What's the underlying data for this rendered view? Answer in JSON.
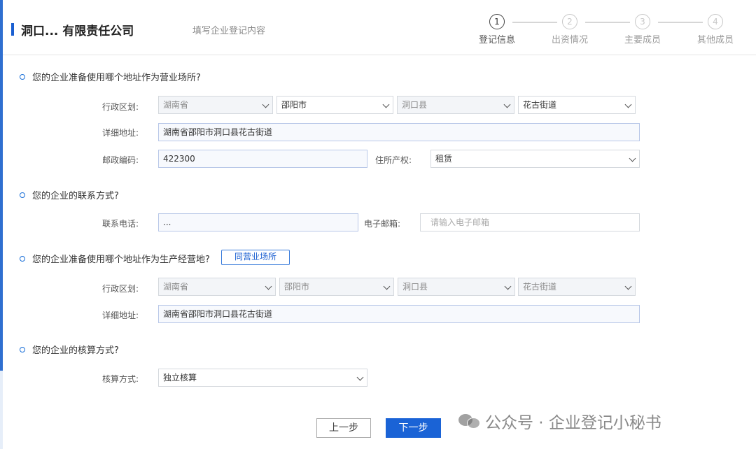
{
  "header": {
    "company_name": "洞口...  有限责任公司",
    "subtitle": "填写企业登记内容"
  },
  "steps": [
    {
      "num": "1",
      "label": "登记信息",
      "active": true
    },
    {
      "num": "2",
      "label": "出资情况",
      "active": false
    },
    {
      "num": "3",
      "label": "主要成员",
      "active": false
    },
    {
      "num": "4",
      "label": "其他成员",
      "active": false
    }
  ],
  "business_site": {
    "question": "您的企业准备使用哪个地址作为营业场所?",
    "region_label": "行政区划:",
    "province": "湖南省",
    "city": "邵阳市",
    "county": "洞口县",
    "street": "花古街道",
    "address_label": "详细地址:",
    "address": "湖南省邵阳市洞口县花古街道",
    "postcode_label": "邮政编码:",
    "postcode": "422300",
    "property_label": "住所产权:",
    "property": "租赁"
  },
  "contact": {
    "question": "您的企业的联系方式?",
    "phone_label": "联系电话:",
    "phone": "...",
    "email_label": "电子邮箱:",
    "email_placeholder": "请输入电子邮箱"
  },
  "production_site": {
    "question": "您的企业准备使用哪个地址作为生产经营地?",
    "same_button": "同营业场所",
    "region_label": "行政区划:",
    "province": "湖南省",
    "city": "邵阳市",
    "county": "洞口县",
    "street": "花古街道",
    "address_label": "详细地址:",
    "address": "湖南省邵阳市洞口县花古街道"
  },
  "accounting": {
    "question": "您的企业的核算方式?",
    "method_label": "核算方式:",
    "method": "独立核算"
  },
  "footer": {
    "prev": "上一步",
    "next": "下一步"
  },
  "watermark": "公众号 · 企业登记小秘书"
}
